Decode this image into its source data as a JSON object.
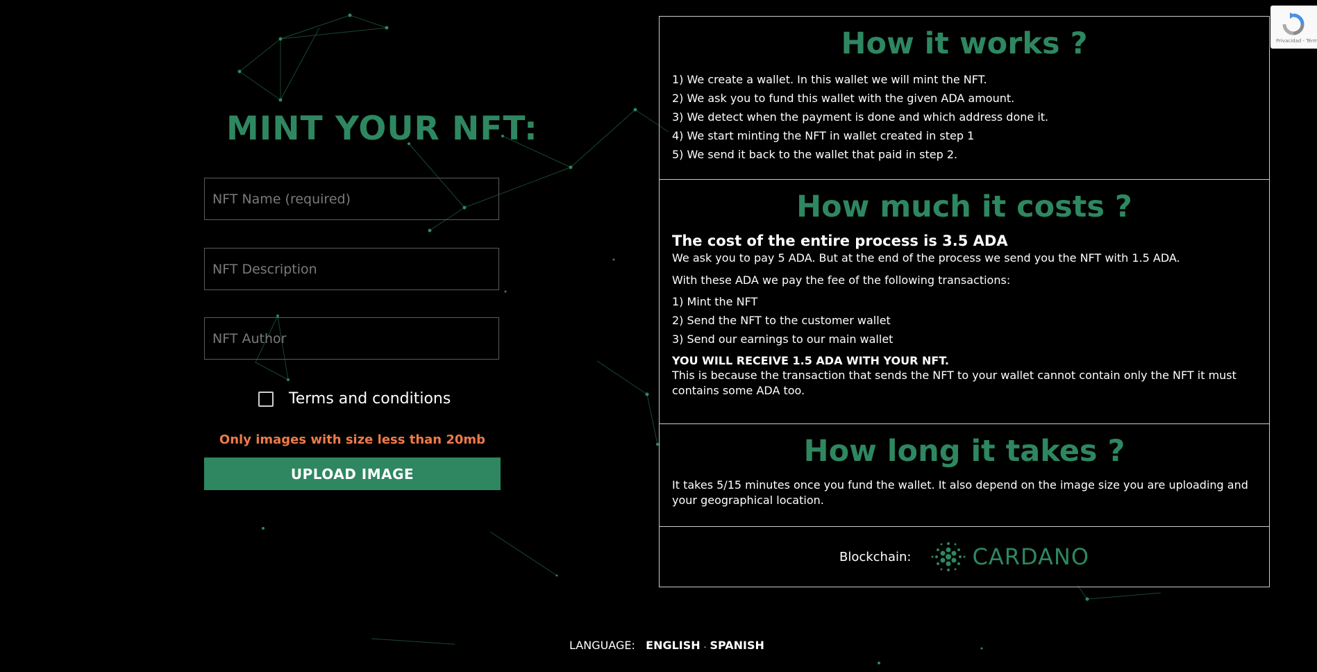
{
  "form": {
    "title": "MINT YOUR NFT:",
    "name_placeholder": "NFT Name (required)",
    "description_placeholder": "NFT Description",
    "author_placeholder": "NFT Author",
    "terms_label": "Terms and conditions",
    "size_note": "Only images with size less than 20mb",
    "upload_label": "UPLOAD IMAGE"
  },
  "how_it_works": {
    "title": "How it works ?",
    "steps": [
      "1) We create a wallet. In this wallet we will mint the NFT.",
      "2) We ask you to fund this wallet with the given ADA amount.",
      "3) We detect when the payment is done and which address done it.",
      "4) We start minting the NFT in wallet created in step 1",
      "5) We send it back to the wallet that paid in step 2."
    ]
  },
  "costs": {
    "title": "How much it costs ?",
    "headline": "The cost of the entire process is 3.5 ADA",
    "intro": "We ask you to pay 5 ADA. But at the end of the process we send you the NFT with 1.5 ADA.",
    "fees_intro": "With these ADA we pay the fee of the following transactions:",
    "fees": [
      "1) Mint the NFT",
      "2) Send the NFT to the customer wallet",
      "3) Send our earnings to our main wallet"
    ],
    "receive_note": "YOU WILL RECEIVE 1.5 ADA WITH YOUR NFT.",
    "receive_explain": "This is because the transaction that sends the NFT to your wallet cannot contain only the NFT it must contains some ADA too."
  },
  "duration": {
    "title": "How long it takes ?",
    "text": "It takes 5/15 minutes once you fund the wallet. It also depend on the image size you are uploading and your geographical location."
  },
  "blockchain": {
    "label": "Blockchain:",
    "name": "CARDANO",
    "logo_icon": "cardano-logo-icon"
  },
  "language": {
    "label": "LANGUAGE:",
    "options": [
      "ENGLISH",
      "SPANISH"
    ],
    "separator": "-"
  },
  "recaptcha": {
    "text": "Privacidad - Términos"
  },
  "colors": {
    "accent": "#2e8760",
    "warning": "#f07a47",
    "background": "#000000"
  }
}
